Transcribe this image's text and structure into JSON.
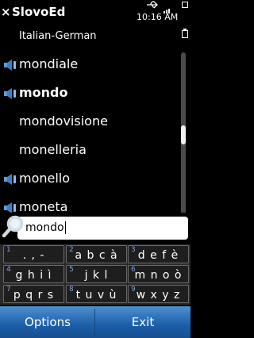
{
  "status": {
    "time": "10:16 AM"
  },
  "title": {
    "close_glyph": "×",
    "app_name": "SlovoEd"
  },
  "dictionary": {
    "name": "Italian-German"
  },
  "list": {
    "items": [
      {
        "word": "mondiale",
        "audio": true,
        "selected": false
      },
      {
        "word": "mondo",
        "audio": true,
        "selected": true
      },
      {
        "word": "mondovisione",
        "audio": false,
        "selected": false
      },
      {
        "word": "monelleria",
        "audio": false,
        "selected": false
      },
      {
        "word": "monello",
        "audio": true,
        "selected": false
      },
      {
        "word": "moneta",
        "audio": true,
        "selected": false
      }
    ]
  },
  "search": {
    "value": "mondo"
  },
  "keypad": {
    "keys": [
      {
        "num": "1",
        "chars": ". , -"
      },
      {
        "num": "2",
        "chars": "a b c à"
      },
      {
        "num": "3",
        "chars": "d e f è"
      },
      {
        "num": "4",
        "chars": "g h i ì"
      },
      {
        "num": "5",
        "chars": "j k l"
      },
      {
        "num": "6",
        "chars": "m n o ò"
      },
      {
        "num": "7",
        "chars": "p q r s"
      },
      {
        "num": "8",
        "chars": "t u v ù"
      },
      {
        "num": "9",
        "chars": "w x y z"
      }
    ]
  },
  "softkeys": {
    "left": "Options",
    "right": "Exit"
  },
  "colors": {
    "softbar": "#1b5fa8",
    "keypad_number": "#7fa2d8"
  }
}
